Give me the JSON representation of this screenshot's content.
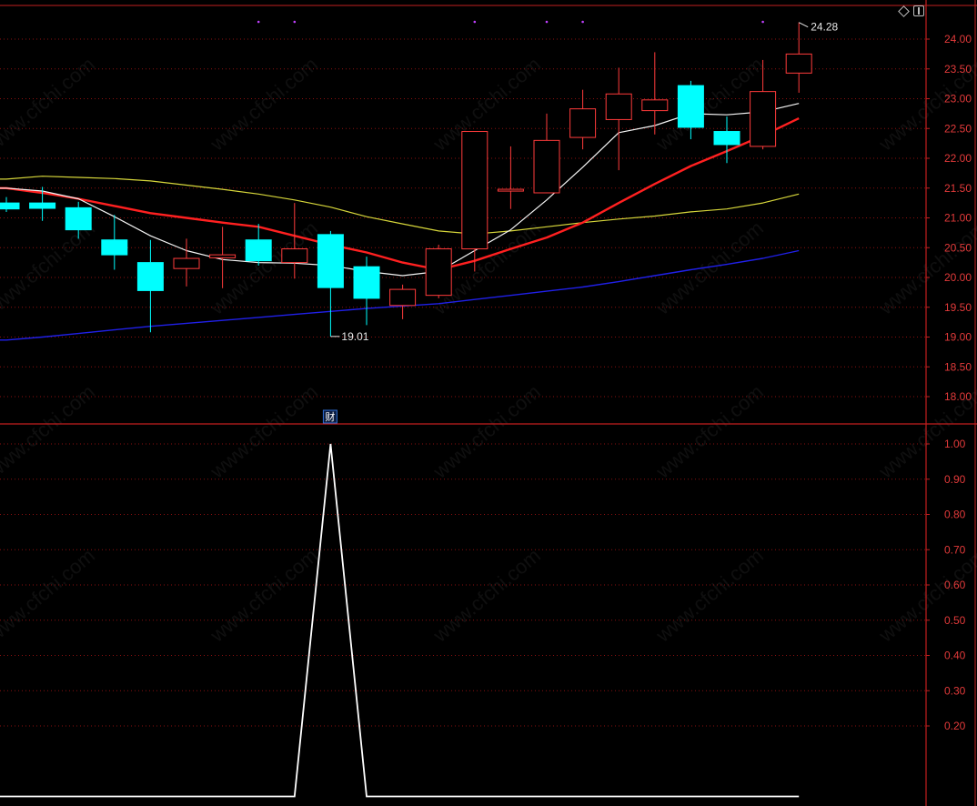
{
  "colors": {
    "background": "#000000",
    "axis": "#c21f1f",
    "tick_text": "#e23a3a",
    "grid": "#8a1010",
    "up_candle": "#ff3b3b",
    "down_candle": "#00ffff",
    "ma_white": "#f5f5f5",
    "ma_yellow": "#d6d63a",
    "ma_red": "#ff2020",
    "ma_blue": "#2020e8",
    "indicator_line": "#ffffff",
    "dot_marker": "#c040ff",
    "finance_marker": "#2f6fd6"
  },
  "icons": [
    "diamond-icon",
    "panel-icon"
  ],
  "watermark": "www.cfchi.com",
  "chart_data": [
    {
      "type": "candlestick",
      "panel": "price",
      "ylim": [
        17.75,
        24.5
      ],
      "yticks": [
        "24.00",
        "23.50",
        "23.00",
        "22.50",
        "22.00",
        "21.50",
        "21.00",
        "20.50",
        "20.00",
        "19.50",
        "19.00",
        "18.50",
        "18.00"
      ],
      "grid": "horizontal dotted",
      "candles": [
        {
          "o": 21.25,
          "h": 21.35,
          "l": 21.1,
          "c": 21.15
        },
        {
          "o": 21.25,
          "h": 21.52,
          "l": 20.95,
          "c": 21.16
        },
        {
          "o": 21.17,
          "h": 21.27,
          "l": 20.65,
          "c": 20.8
        },
        {
          "o": 20.63,
          "h": 21.05,
          "l": 20.13,
          "c": 20.38
        },
        {
          "o": 20.25,
          "h": 20.63,
          "l": 19.08,
          "c": 19.78
        },
        {
          "o": 20.15,
          "h": 20.65,
          "l": 19.85,
          "c": 20.32
        },
        {
          "o": 20.33,
          "h": 20.85,
          "l": 19.82,
          "c": 20.38
        },
        {
          "o": 20.63,
          "h": 20.9,
          "l": 20.2,
          "c": 20.28
        },
        {
          "o": 20.25,
          "h": 21.25,
          "l": 19.98,
          "c": 20.48
        },
        {
          "o": 20.72,
          "h": 20.78,
          "l": 19.01,
          "c": 19.83
        },
        {
          "o": 20.18,
          "h": 20.35,
          "l": 19.2,
          "c": 19.65
        },
        {
          "o": 19.53,
          "h": 19.88,
          "l": 19.3,
          "c": 19.8
        },
        {
          "o": 19.7,
          "h": 20.55,
          "l": 19.65,
          "c": 20.48
        },
        {
          "o": 20.48,
          "h": 22.45,
          "l": 20.1,
          "c": 22.45
        },
        {
          "o": 21.45,
          "h": 22.2,
          "l": 21.15,
          "c": 21.48
        },
        {
          "o": 21.42,
          "h": 22.75,
          "l": 21.42,
          "c": 22.3
        },
        {
          "o": 22.35,
          "h": 23.15,
          "l": 22.15,
          "c": 22.83
        },
        {
          "o": 22.65,
          "h": 23.52,
          "l": 21.8,
          "c": 23.08
        },
        {
          "o": 22.8,
          "h": 23.78,
          "l": 22.4,
          "c": 22.98
        },
        {
          "o": 23.22,
          "h": 23.3,
          "l": 22.32,
          "c": 22.52
        },
        {
          "o": 22.45,
          "h": 22.7,
          "l": 21.92,
          "c": 22.23
        },
        {
          "o": 22.2,
          "h": 23.65,
          "l": 22.15,
          "c": 23.12
        },
        {
          "o": 23.43,
          "h": 24.28,
          "l": 23.1,
          "c": 23.75
        }
      ],
      "ma_white": [
        21.5,
        21.45,
        21.32,
        21.02,
        20.7,
        20.45,
        20.3,
        20.25,
        20.24,
        20.2,
        20.1,
        20.03,
        20.1,
        20.45,
        20.8,
        21.3,
        21.85,
        22.43,
        22.55,
        22.75,
        22.73,
        22.78,
        22.92
      ],
      "ma_red": [
        21.5,
        21.42,
        21.32,
        21.2,
        21.08,
        21.0,
        20.92,
        20.85,
        20.7,
        20.55,
        20.42,
        20.25,
        20.13,
        20.28,
        20.48,
        20.67,
        20.92,
        21.25,
        21.57,
        21.87,
        22.12,
        22.38,
        22.67
      ],
      "ma_yellow": [
        21.65,
        21.7,
        21.68,
        21.66,
        21.62,
        21.55,
        21.48,
        21.4,
        21.3,
        21.18,
        21.02,
        20.9,
        20.78,
        20.73,
        20.78,
        20.85,
        20.92,
        20.98,
        21.03,
        21.1,
        21.15,
        21.25,
        21.4
      ],
      "ma_blue": [
        18.95,
        19.0,
        19.06,
        19.12,
        19.18,
        19.23,
        19.28,
        19.33,
        19.38,
        19.43,
        19.48,
        19.52,
        19.56,
        19.63,
        19.7,
        19.77,
        19.84,
        19.93,
        20.03,
        20.13,
        20.22,
        20.32,
        20.45
      ],
      "annotations": {
        "high_label": "24.28",
        "low_label": "19.01"
      },
      "dot_marker_candles": [
        7,
        8,
        13,
        15,
        16,
        21
      ],
      "finance_marker": "财"
    },
    {
      "type": "line",
      "panel": "indicator",
      "ylim": [
        -0.02,
        1.04
      ],
      "yticks": [
        "1.00",
        "0.90",
        "0.80",
        "0.70",
        "0.60",
        "0.50",
        "0.40",
        "0.30",
        "0.20"
      ],
      "values": [
        0,
        0,
        0,
        0,
        0,
        0,
        0,
        0,
        0,
        1,
        0,
        0,
        0,
        0,
        0,
        0,
        0,
        0,
        0,
        0,
        0,
        0,
        0
      ]
    }
  ]
}
